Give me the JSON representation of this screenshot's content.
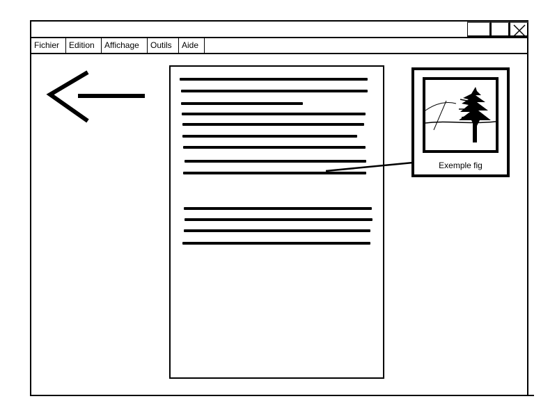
{
  "window": {
    "buttons": {
      "minimize": "minimize-icon",
      "maximize": "maximize-icon",
      "close": "close-icon"
    }
  },
  "menu": {
    "items": [
      "Fichier",
      "Edition",
      "Affichage",
      "Outils",
      "Aide"
    ]
  },
  "toolbar": {
    "back_icon": "left-arrow-icon"
  },
  "figure": {
    "caption": "Exemple fig",
    "image_icon": "tree-landscape-icon"
  }
}
